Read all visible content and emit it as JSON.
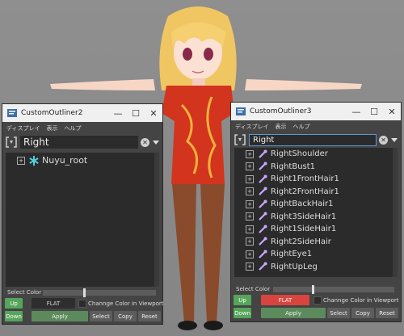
{
  "colors": {
    "title_bg": "#f0f0f0",
    "panel_bg": "#444444",
    "field_bg": "#2b2b2b",
    "up_down_green": "#55a55a",
    "flat_red": "#d9443f",
    "bone_color": "#c9a8ff",
    "root_icon_color": "#4fd1d9"
  },
  "left": {
    "title": "CustomOutliner2",
    "title_buttons": [
      "—",
      "☐",
      "✕"
    ],
    "menu": [
      "ディスプレイ",
      "表示",
      "ヘルプ"
    ],
    "search_value": "Right",
    "tree": [
      {
        "label": "Nuyu_root",
        "icon": "root-asterisk-icon",
        "expander": "+"
      }
    ],
    "select_color_label": "Select Color",
    "up_label": "Up",
    "down_label": "Down",
    "flat_label": "FLAT",
    "change_color_label": "Channge Color in Viewport",
    "apply_label": "Apply",
    "select_label": "Select",
    "copy_label": "Copy",
    "reset_label": "Reset"
  },
  "right": {
    "title": "CustomOutliner3",
    "title_buttons": [
      "—",
      "☐",
      "✕"
    ],
    "menu": [
      "ディスプレイ",
      "表示",
      "ヘルプ"
    ],
    "search_value": "Right",
    "tree": [
      {
        "label": "RightShoulder",
        "icon": "bone-icon",
        "expander": "+"
      },
      {
        "label": "RightBust1",
        "icon": "bone-icon",
        "expander": "+"
      },
      {
        "label": "Right1FrontHair1",
        "icon": "bone-icon",
        "expander": "+"
      },
      {
        "label": "Right2FrontHair1",
        "icon": "bone-icon",
        "expander": "+"
      },
      {
        "label": "RightBackHair1",
        "icon": "bone-icon",
        "expander": "+"
      },
      {
        "label": "Right3SideHair1",
        "icon": "bone-icon",
        "expander": "+"
      },
      {
        "label": "Right1SideHair1",
        "icon": "bone-icon",
        "expander": "+"
      },
      {
        "label": "Right2SideHair",
        "icon": "bone-icon",
        "expander": "+"
      },
      {
        "label": "RightEye1",
        "icon": "bone-icon",
        "expander": "+"
      },
      {
        "label": "RightUpLeg",
        "icon": "bone-icon",
        "expander": "+"
      }
    ],
    "select_color_label": "Select Color",
    "up_label": "Up",
    "down_label": "Down",
    "flat_label": "FLAT",
    "change_color_label": "Channge Color in Viewport",
    "apply_label": "Apply",
    "select_label": "Select",
    "copy_label": "Copy",
    "reset_label": "Reset"
  }
}
